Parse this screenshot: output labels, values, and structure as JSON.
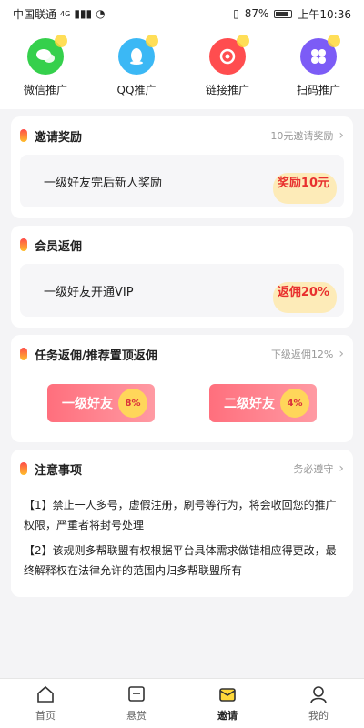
{
  "status_bar": {
    "carrier": "中国联通",
    "signal_type": "4G",
    "battery": "87%",
    "time": "上午10:36"
  },
  "quick_actions": [
    {
      "label": "微信推广",
      "icon": "wechat-icon",
      "color": "#35d04c"
    },
    {
      "label": "QQ推广",
      "icon": "qq-icon",
      "color": "#3bb8f5"
    },
    {
      "label": "链接推广",
      "icon": "link-icon",
      "color": "#ff4d4f"
    },
    {
      "label": "扫码推广",
      "icon": "scan-icon",
      "color": "#7c5cf6"
    }
  ],
  "invite_reward": {
    "title": "邀请奖励",
    "more": "10元邀请奖励",
    "text": "一级好友完后新人奖励",
    "value": "奖励10元"
  },
  "member_rebate": {
    "title": "会员返佣",
    "text": "一级好友开通VIP",
    "value": "返佣20%"
  },
  "task_rebate": {
    "title": "任务返佣/推荐置顶返佣",
    "more": "下级返佣12%",
    "tiers": [
      {
        "label": "一级好友",
        "badge": "8%"
      },
      {
        "label": "二级好友",
        "badge": "4%"
      }
    ]
  },
  "notes": {
    "title": "注意事项",
    "more": "务必遵守",
    "items": [
      "【1】禁止一人多号，虚假注册，刷号等行为，将会收回您的推广权限，严重者将封号处理",
      "【2】该规则多帮联盟有权根据平台具体需求做错相应得更改，最终解释权在法律允许的范围内归多帮联盟所有"
    ]
  },
  "tabs": [
    {
      "label": "首页",
      "icon": "home-icon"
    },
    {
      "label": "悬赏",
      "icon": "reward-icon"
    },
    {
      "label": "邀请",
      "icon": "invite-icon",
      "active": true
    },
    {
      "label": "我的",
      "icon": "profile-icon"
    }
  ]
}
